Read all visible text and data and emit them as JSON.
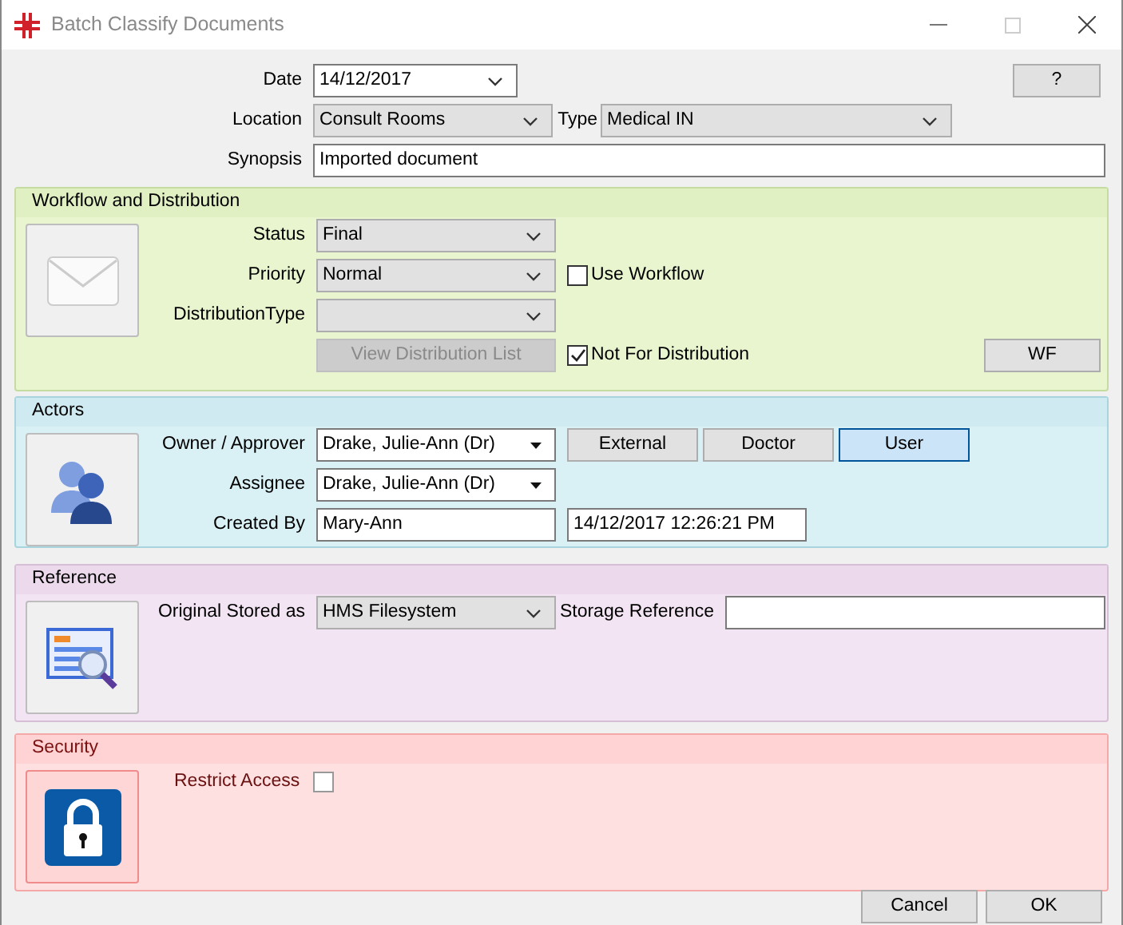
{
  "window": {
    "title": "Batch Classify Documents"
  },
  "header": {
    "date": {
      "label": "Date",
      "value": "14/12/2017"
    },
    "help_button": "?",
    "location": {
      "label": "Location",
      "value": "Consult Rooms"
    },
    "type": {
      "label": "Type",
      "value": "Medical IN"
    },
    "synopsis": {
      "label": "Synopsis",
      "value": "Imported document"
    }
  },
  "workflow": {
    "title": "Workflow and Distribution",
    "status": {
      "label": "Status",
      "value": "Final"
    },
    "priority": {
      "label": "Priority",
      "value": "Normal"
    },
    "use_workflow": {
      "label": "Use Workflow",
      "checked": false
    },
    "distribution_type": {
      "label": "DistributionType"
    },
    "view_distribution_list": {
      "label": "View Distribution List",
      "disabled": true
    },
    "not_for_distribution": {
      "label": "Not For Distribution",
      "checked": true
    },
    "wf_button": "WF"
  },
  "actors": {
    "title": "Actors",
    "owner": {
      "label": "Owner / Approver",
      "value": "Drake, Julie-Ann (Dr)"
    },
    "filters": [
      {
        "label": "External",
        "selected": false
      },
      {
        "label": "Doctor",
        "selected": false
      },
      {
        "label": "User",
        "selected": true
      }
    ],
    "assignee": {
      "label": "Assignee",
      "value": "Drake, Julie-Ann (Dr)"
    },
    "created_by": {
      "label": "Created By",
      "value": "Mary-Ann"
    },
    "created_at": "14/12/2017 12:26:21 PM"
  },
  "reference": {
    "title": "Reference",
    "original_stored_as": {
      "label": "Original Stored as",
      "value": "HMS Filesystem"
    },
    "storage_reference": {
      "label": "Storage Reference"
    }
  },
  "security": {
    "title": "Security",
    "restrict_access": {
      "label": "Restrict Access",
      "checked": false
    }
  },
  "buttons": [
    "Cancel",
    "OK"
  ]
}
